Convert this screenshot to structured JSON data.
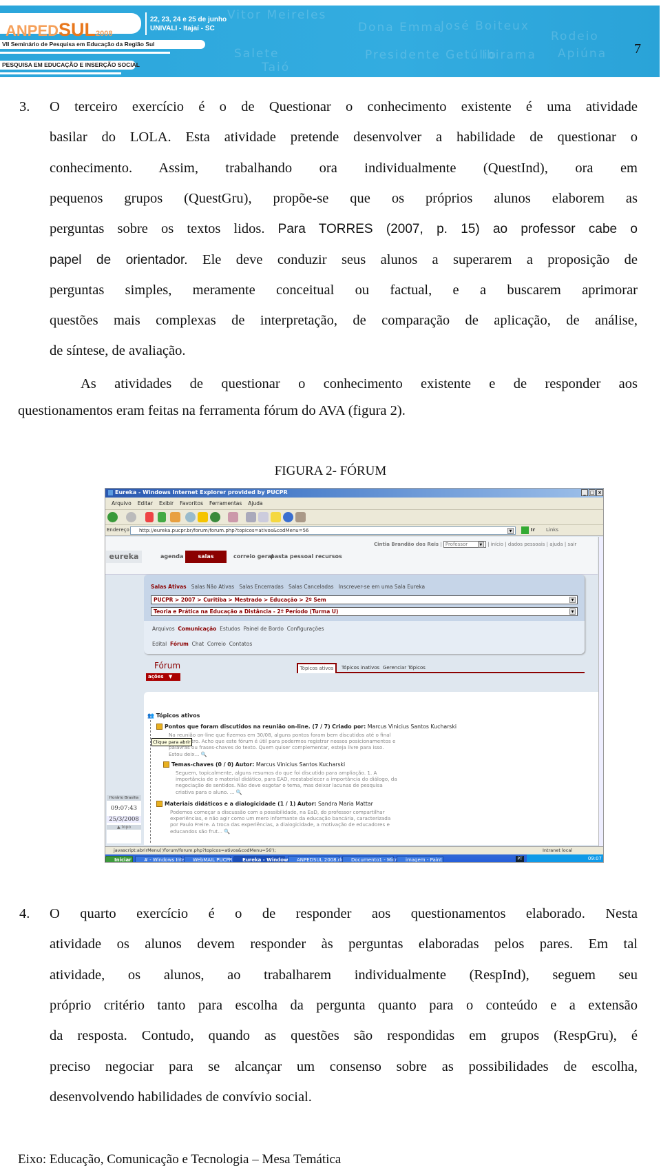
{
  "header": {
    "logo_text": "ANPEDSUL2008",
    "logo_parts": [
      "ANPED",
      "SUL",
      "2008"
    ],
    "dates": "22, 23, 24 e 25 de junho",
    "location": "UNIVALI - Itajaí - SC",
    "seminar": "VII Seminário de Pesquisa em Educação da Região Sul",
    "theme": "PESQUISA EM EDUCAÇÃO E INSERÇÃO SOCIAL",
    "page_number": "7",
    "colors": {
      "banner": "#2ba6db",
      "logo_light": "#f5a05a",
      "logo_dark": "#e8781e"
    }
  },
  "section3": {
    "number": "3.",
    "lines": [
      [
        {
          "t": "O terceiro exercício é o de Questionar o conhecimento existente é uma atividade"
        }
      ],
      [
        {
          "t": "basilar do LOLA. Esta atividade pretende desenvolver a habilidade de questionar o"
        }
      ],
      [
        {
          "t": "conhecimento. Assim, trabalhando ora individualmente (QuestInd), ora em"
        }
      ],
      [
        {
          "t": "pequenos grupos (QuestGru), propõe-se que os próprios alunos elaborem as"
        }
      ],
      [
        {
          "t": "perguntas sobre os textos lidos. "
        },
        {
          "t": "Para TORRES (2007, p. 15) ao professor cabe o",
          "sans": true
        }
      ],
      [
        {
          "t": "papel de orientador. ",
          "sans": true
        },
        {
          "t": "Ele deve conduzir seus alunos a superarem a proposição de"
        }
      ],
      [
        {
          "t": "perguntas simples, meramente conceitual ou factual, e a buscarem aprimorar"
        }
      ],
      [
        {
          "t": "questões mais complexas de interpretação, de comparação de aplicação, de análise,"
        }
      ],
      [
        {
          "t": "de síntese, de avaliação."
        }
      ]
    ]
  },
  "paragraph2": {
    "lines": [
      [
        {
          "t": "As atividades de questionar o conhecimento existente e de responder aos"
        }
      ],
      [
        {
          "t": "questionamentos eram feitas na ferramenta fórum do AVA (figura 2)."
        }
      ]
    ]
  },
  "figure": {
    "caption": "FIGURA 2- FÓRUM",
    "window_title": "Eureka - Windows Internet Explorer provided by PUCPR",
    "menu": [
      "Arquivo",
      "Editar",
      "Exibir",
      "Favoritos",
      "Ferramentas",
      "Ajuda"
    ],
    "address_label": "Endereço",
    "url": "http://eureka.pucpr.br/forum/forum.php?topicos=ativos&codMenu=56",
    "go_label": "Ir",
    "links_label": "Links",
    "user_name": "Cintia Brandão dos Reis",
    "role": "Professor",
    "top_links": [
      "início",
      "dados pessoais",
      "ajuda",
      "sair"
    ],
    "logo": "eureka",
    "nav": [
      "agenda",
      "salas",
      "correio geral",
      "pasta pessoal",
      "recursos"
    ],
    "room_tabs": [
      "Salas Ativas",
      "Salas Não Ativas",
      "Salas Encerradas",
      "Salas Canceladas",
      "Inscrever-se em uma Sala Eureka"
    ],
    "breadcrumb": "PUCPR > 2007 > Curitiba > Mestrado > Educação > 2º Sem",
    "course": "Teoria e Prática na Educação a Distância - 2º Período (Turma U)",
    "sections": [
      "Arquivos",
      "Comunicação",
      "Estudos",
      "Painel de Bordo",
      "Configurações"
    ],
    "subsections": [
      "Edital",
      "Fórum",
      "Chat",
      "Correio",
      "Contatos"
    ],
    "forum_title": "Fórum",
    "actions": "ações",
    "forum_tabs": [
      "Tópicos ativos",
      "Tópicos inativos",
      "Gerenciar Tópicos"
    ],
    "list_heading": "Tópicos ativos",
    "tooltip": "Clique para abrir",
    "topics": [
      {
        "title": "Pontos que foram discutidos na reunião on-line. (7 / 7)",
        "by_label": "Criado por:",
        "author": "Marcus Vinicius Santos Kucharski",
        "desc": [
          "Na reunião on-line que fizemos em 30/08, alguns pontos foram bem discutidos até o final",
          "do encontro. Acho que este fórum é útil para podermos registrar nossos posicionamentos e",
          "palavras ou frases-chaves do texto. Quem quiser complementar, esteja livre para isso.",
          "Estou deix... "
        ]
      },
      {
        "title": "Temas-chaves (0 / 0)",
        "by_label": "Autor:",
        "author": "Marcus Vinicius Santos Kucharski",
        "desc": [
          "Seguem, topicalmente, alguns resumos do que foi discutido para ampliação. 1. A",
          "importância de o material didático, para EAD, reestabelecer a importância do diálogo, da",
          "negociação de sentidos. Não deve esgotar o tema, mas deixar lacunas de pesquisa",
          "criativa para o aluno. ... "
        ]
      },
      {
        "title": "Materiais didáticos e a dialogicidade (1 / 1)",
        "by_label": "Autor:",
        "author": "Sandra Maria Mattar",
        "desc": [
          "Podemos começar a discussão com a possibilidade, na EaD, do professor compartilhar",
          "experiências, e não agir como um mero informante da educação bancária, caracterizada",
          "por Paulo Freire. A troca das experiências, a dialogicidade, a motivação de educadores e",
          "educandos são frut... "
        ]
      }
    ],
    "clock_label": "Horário Brasília",
    "clock_time": "09:07:43",
    "clock_date": "25/3/2008",
    "top_link": "topo",
    "status_text": "javascript:abrirMenu('/forum/forum.php?topicos=ativos&codMenu=56');",
    "zone": "Intranet local",
    "start": "Iniciar",
    "tasks": [
      "# - Windows Intern...",
      "WebMAIL PUCPR - ...",
      "Eureka - Windows...",
      "ANPEDSUL 2008.do...",
      "Documento1 - Micro...",
      "imagem - Paint"
    ],
    "lang": "PT",
    "tray_time": "09:07",
    "accent": "#8b0000"
  },
  "section4": {
    "number": "4.",
    "lines": [
      [
        {
          "t": "O quarto exercício é o de responder aos questionamentos elaborado. Nesta"
        }
      ],
      [
        {
          "t": "atividade os alunos devem responder às perguntas elaboradas pelos pares. Em tal"
        }
      ],
      [
        {
          "t": "atividade, os alunos, ao trabalharem individualmente (RespInd), seguem seu"
        }
      ],
      [
        {
          "t": "próprio critério tanto para escolha da pergunta quanto para o conteúdo e a extensão"
        }
      ],
      [
        {
          "t": "da resposta. Contudo, quando as questões são respondidas em grupos (RespGru), é"
        }
      ],
      [
        {
          "t": "preciso negociar para se alcançar um consenso sobre as possibilidades de escolha,"
        }
      ],
      [
        {
          "t": "desenvolvendo habilidades de convívio social."
        }
      ]
    ]
  },
  "footer": "Eixo: Educação, Comunicação e Tecnologia – Mesa Temática"
}
